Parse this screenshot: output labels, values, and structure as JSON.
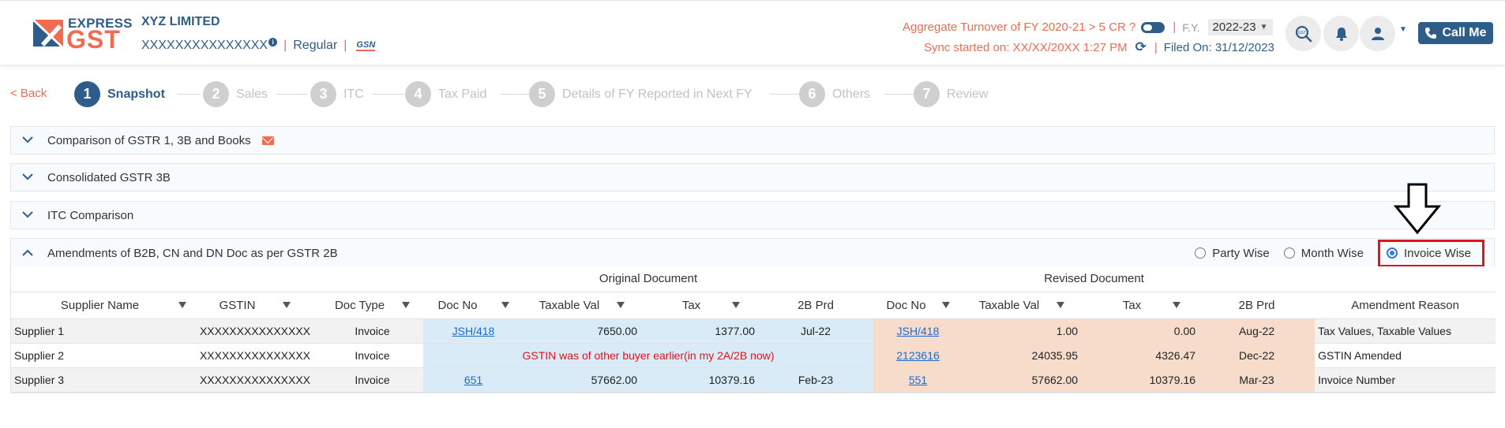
{
  "logo": {
    "express": "EXPRESS",
    "gst": "GST"
  },
  "company": {
    "name": "XYZ LIMITED",
    "gstin": "XXXXXXXXXXXXXXX",
    "type": "Regular",
    "gsn_icon": "GSN"
  },
  "header": {
    "turnover": "Aggregate Turnover of FY 2020-21 > 5 CR ?",
    "fy_label": "F.Y.",
    "fy_value": "2022-23",
    "sync": "Sync started on: XX/XX/20XX 1:27 PM",
    "filed": "Filed On: 31/12/2023",
    "call_label": "Call Me"
  },
  "icons": {
    "search": "search-icon",
    "bell": "bell-icon",
    "user": "user-icon",
    "phone": "phone-icon"
  },
  "stepper": {
    "back": "< Back",
    "steps": [
      {
        "num": "1",
        "label": "Snapshot"
      },
      {
        "num": "2",
        "label": "Sales"
      },
      {
        "num": "3",
        "label": "ITC"
      },
      {
        "num": "4",
        "label": "Tax Paid"
      },
      {
        "num": "5",
        "label": "Details of FY Reported in Next FY"
      },
      {
        "num": "6",
        "label": "Others"
      },
      {
        "num": "7",
        "label": "Review"
      }
    ]
  },
  "accordions": [
    {
      "title": "Comparison of GSTR 1, 3B and Books"
    },
    {
      "title": "Consolidated GSTR 3B"
    },
    {
      "title": "ITC Comparison"
    },
    {
      "title": "Amendments of B2B, CN and DN Doc as per GSTR 2B"
    }
  ],
  "view_options": [
    {
      "label": "Party Wise",
      "checked": false
    },
    {
      "label": "Month Wise",
      "checked": false
    },
    {
      "label": "Invoice Wise",
      "checked": true
    }
  ],
  "table": {
    "group_original": "Original Document",
    "group_revised": "Revised Document",
    "columns": [
      "Supplier Name",
      "GSTIN",
      "Doc Type",
      "Doc No",
      "Taxable Val",
      "Tax",
      "2B Prd",
      "Doc No",
      "Taxable Val",
      "Tax",
      "2B Prd",
      "Amendment Reason"
    ],
    "rows": [
      {
        "supplier": "Supplier 1",
        "gstin": "XXXXXXXXXXXXXXX",
        "doc_type": "Invoice",
        "orig_doc_no": "JSH/418",
        "orig_taxable": "7650.00",
        "orig_tax": "1377.00",
        "orig_prd": "Jul-22",
        "rev_doc_no": "JSH/418",
        "rev_taxable": "1.00",
        "rev_tax": "0.00",
        "rev_prd": "Aug-22",
        "reason": "Tax Values, Taxable Values"
      },
      {
        "supplier": "Supplier 2",
        "gstin": "XXXXXXXXXXXXXXX",
        "doc_type": "Invoice",
        "orig_note": "GSTIN was of other buyer earlier(in my 2A/2B now)",
        "rev_doc_no": "2123616",
        "rev_taxable": "24035.95",
        "rev_tax": "4326.47",
        "rev_prd": "Dec-22",
        "reason": "GSTIN Amended"
      },
      {
        "supplier": "Supplier 3",
        "gstin": "XXXXXXXXXXXXXXX",
        "doc_type": "Invoice",
        "orig_doc_no": "651",
        "orig_taxable": "57662.00",
        "orig_tax": "10379.16",
        "orig_prd": "Feb-23",
        "rev_doc_no": "551",
        "rev_taxable": "57662.00",
        "rev_tax": "10379.16",
        "rev_prd": "Mar-23",
        "reason": "Invoice Number"
      }
    ]
  },
  "colors": {
    "brand_blue": "#2f5d8a",
    "brand_orange": "#ef6b52",
    "highlight_red": "#e0141c",
    "orig_bg": "#d8ebf6",
    "rev_bg": "#f7dccb"
  }
}
